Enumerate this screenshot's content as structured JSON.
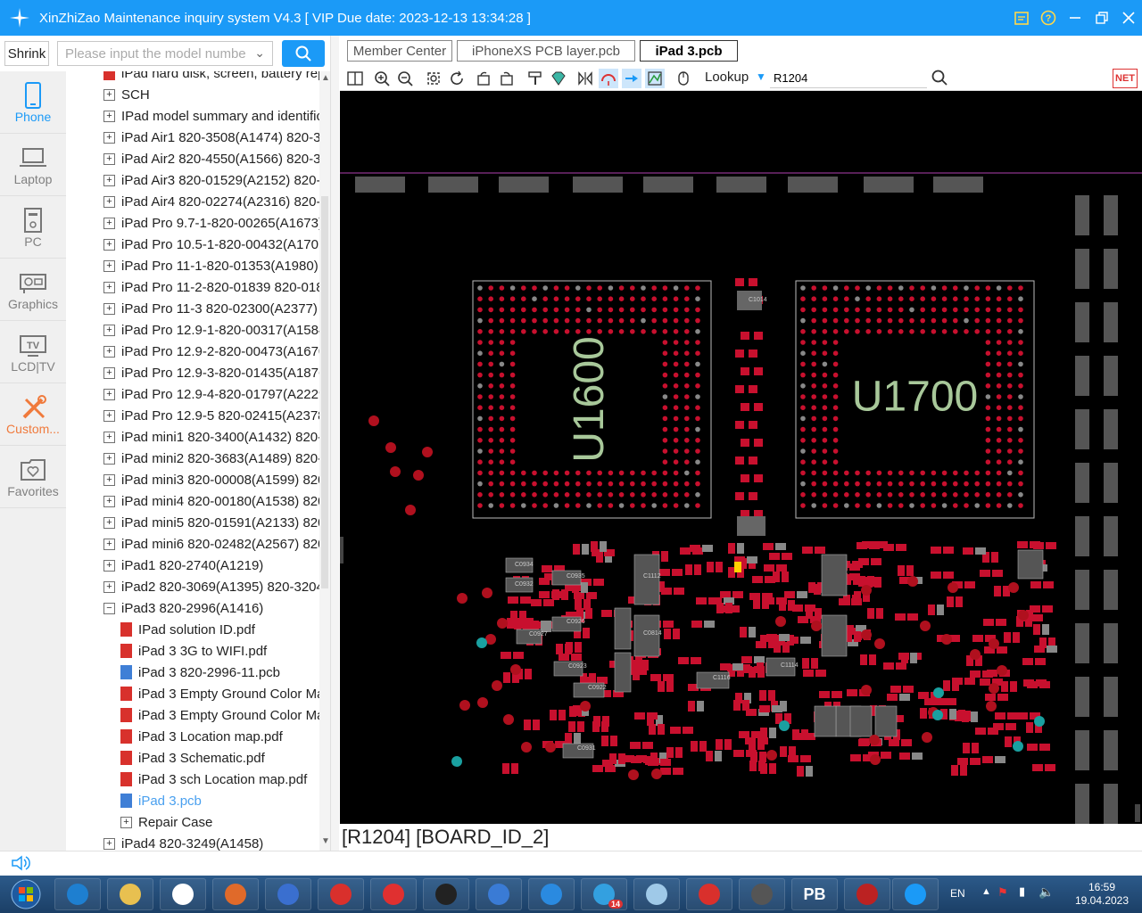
{
  "app": {
    "title": "XinZhiZao Maintenance inquiry system V4.3 [ VIP Due date: 2023-12-13 13:34:28 ]"
  },
  "left_nav": [
    {
      "label": "Phone",
      "icon": "phone-icon"
    },
    {
      "label": "Laptop",
      "icon": "laptop-icon"
    },
    {
      "label": "PC",
      "icon": "pc-icon"
    },
    {
      "label": "Graphics",
      "icon": "graphics-card-icon"
    },
    {
      "label": "LCD|TV",
      "icon": "tv-icon"
    },
    {
      "label": "Custom...",
      "icon": "custom-tools-icon"
    },
    {
      "label": "Favorites",
      "icon": "favorites-icon"
    }
  ],
  "search": {
    "shrink_label": "Shrink",
    "placeholder": "Please input the model numbe"
  },
  "tree": [
    {
      "label": "iPad hard disk, screen, battery replacement",
      "level": 0,
      "kind": "pdf"
    },
    {
      "label": "SCH",
      "level": 0,
      "kind": "plus"
    },
    {
      "label": "IPad model summary and identification",
      "level": 0,
      "kind": "plus"
    },
    {
      "label": "iPad Air1 820-3508(A1474) 820-3",
      "level": 0,
      "kind": "plus"
    },
    {
      "label": "iPad Air2 820-4550(A1566) 820-3",
      "level": 0,
      "kind": "plus"
    },
    {
      "label": "iPad Air3 820-01529(A2152) 820-0",
      "level": 0,
      "kind": "plus"
    },
    {
      "label": "iPad Air4 820-02274(A2316) 820-0",
      "level": 0,
      "kind": "plus"
    },
    {
      "label": "iPad Pro 9.7-1-820-00265(A1673)",
      "level": 0,
      "kind": "plus"
    },
    {
      "label": "iPad Pro 10.5-1-820-00432(A1701",
      "level": 0,
      "kind": "plus"
    },
    {
      "label": "iPad Pro 11-1-820-01353(A1980)",
      "level": 0,
      "kind": "plus"
    },
    {
      "label": "iPad Pro 11-2-820-01839 820-018",
      "level": 0,
      "kind": "plus"
    },
    {
      "label": "iPad Pro 11-3 820-02300(A2377) 8",
      "level": 0,
      "kind": "plus"
    },
    {
      "label": "iPad Pro 12.9-1-820-00317(A1584",
      "level": 0,
      "kind": "plus"
    },
    {
      "label": "iPad Pro 12.9-2-820-00473(A1670",
      "level": 0,
      "kind": "plus"
    },
    {
      "label": "iPad Pro 12.9-3-820-01435(A1876",
      "level": 0,
      "kind": "plus"
    },
    {
      "label": "iPad Pro 12.9-4-820-01797(A2229",
      "level": 0,
      "kind": "plus"
    },
    {
      "label": "iPad Pro 12.9-5 820-02415(A2378",
      "level": 0,
      "kind": "plus"
    },
    {
      "label": "iPad mini1 820-3400(A1432) 820-",
      "level": 0,
      "kind": "plus"
    },
    {
      "label": "iPad mini2 820-3683(A1489) 820-",
      "level": 0,
      "kind": "plus"
    },
    {
      "label": "iPad mini3 820-00008(A1599) 820",
      "level": 0,
      "kind": "plus"
    },
    {
      "label": "iPad mini4 820-00180(A1538) 820",
      "level": 0,
      "kind": "plus"
    },
    {
      "label": "iPad mini5 820-01591(A2133) 820",
      "level": 0,
      "kind": "plus"
    },
    {
      "label": "iPad mini6 820-02482(A2567) 820",
      "level": 0,
      "kind": "plus"
    },
    {
      "label": "iPad1 820-2740(A1219)",
      "level": 0,
      "kind": "plus"
    },
    {
      "label": "iPad2 820-3069(A1395) 820-3204",
      "level": 0,
      "kind": "plus"
    },
    {
      "label": "iPad3 820-2996(A1416)",
      "level": 0,
      "kind": "minus"
    },
    {
      "label": "IPad solution ID.pdf",
      "level": 1,
      "kind": "pdf"
    },
    {
      "label": "iPad 3 3G to WIFI.pdf",
      "level": 1,
      "kind": "pdf"
    },
    {
      "label": "iPad 3 820-2996-11.pcb",
      "level": 1,
      "kind": "pcb"
    },
    {
      "label": "iPad 3 Empty Ground Color Ma",
      "level": 1,
      "kind": "pdf"
    },
    {
      "label": "iPad 3 Empty Ground Color Ma",
      "level": 1,
      "kind": "pdf"
    },
    {
      "label": "iPad 3 Location map.pdf",
      "level": 1,
      "kind": "pdf"
    },
    {
      "label": "iPad 3 Schematic.pdf",
      "level": 1,
      "kind": "pdf"
    },
    {
      "label": "iPad 3 sch Location map.pdf",
      "level": 1,
      "kind": "pdf"
    },
    {
      "label": "iPad 3.pcb",
      "level": 1,
      "kind": "pcb",
      "selected": true
    },
    {
      "label": "Repair Case",
      "level": 1,
      "kind": "plus"
    },
    {
      "label": "iPad4 820-3249(A1458)",
      "level": 0,
      "kind": "plus"
    }
  ],
  "tabs": [
    {
      "label": "Member Center",
      "active": false
    },
    {
      "label": "iPhoneXS PCB layer.pcb",
      "active": false
    },
    {
      "label": "iPad 3.pcb",
      "active": true
    }
  ],
  "toolbar": {
    "lookup_label": "Lookup",
    "lookup_value": "R1204",
    "net_label": "NET"
  },
  "pcb": {
    "chip1_label": "U1600",
    "chip2_label": "U1700",
    "small_labels": [
      "C1014",
      "C0934",
      "C0932",
      "C0935",
      "C0926",
      "C0927",
      "C0923",
      "C0922",
      "C0931",
      "C1112",
      "C0814",
      "C1116",
      "C1114"
    ]
  },
  "status": {
    "text": "[R1204] [BOARD_ID_2]"
  },
  "taskbar": {
    "lang": "EN",
    "time": "16:59",
    "date": "19.04.2023",
    "apps": [
      "ie-icon",
      "explorer-icon",
      "chrome-icon",
      "firefox-like-icon",
      "ir-icon",
      "location-icon",
      "dz-icon",
      "nch-icon",
      "installer-icon",
      "z-icon",
      "telegram-icon",
      "notes-icon",
      "acrobat-icon",
      "tool-icon",
      "pb-icon",
      "wt-icon",
      "xinzhizao-icon"
    ],
    "pb_label": "PB",
    "telegram_badge": "14"
  },
  "colors": {
    "accent": "#1b9af7",
    "pcb_bg": "#000000",
    "pad_red": "#c8102e",
    "pad_gray": "#888888",
    "chip_text": "#a8c89a"
  }
}
